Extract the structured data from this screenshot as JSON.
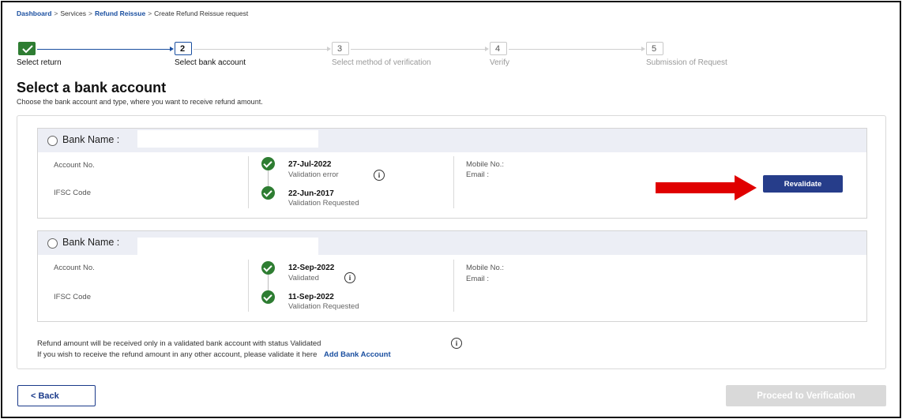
{
  "breadcrumb": {
    "items": [
      "Dashboard",
      "Services",
      "Refund Reissue",
      "Create Refund Reissue request"
    ],
    "separator": ">"
  },
  "stepper": {
    "steps": [
      {
        "number": "",
        "label": "Select return",
        "state": "completed"
      },
      {
        "number": "2",
        "label": "Select bank account",
        "state": "active"
      },
      {
        "number": "3",
        "label": "Select method of verification",
        "state": "pending"
      },
      {
        "number": "4",
        "label": "Verify",
        "state": "pending"
      },
      {
        "number": "5",
        "label": "Submission of Request",
        "state": "pending"
      }
    ]
  },
  "page": {
    "title": "Select a bank account",
    "subtitle": "Choose the bank account and type, where you want to receive refund amount."
  },
  "accounts": [
    {
      "bank_name_label": "Bank Name :",
      "account_no_label": "Account No.",
      "ifsc_label": "IFSC Code",
      "event1_date": "27-Jul-2022",
      "event1_status": "Validation error",
      "event2_date": "22-Jun-2017",
      "event2_status": "Validation Requested",
      "mobile_label": "Mobile No.:",
      "email_label": "Email :",
      "action_label": "Revalidate"
    },
    {
      "bank_name_label": "Bank Name :",
      "account_no_label": "Account No.",
      "ifsc_label": "IFSC Code",
      "event1_date": "12-Sep-2022",
      "event1_status": "Validated",
      "event2_date": "11-Sep-2022",
      "event2_status": "Validation Requested",
      "mobile_label": "Mobile No.:",
      "email_label": "Email :"
    }
  ],
  "notes": {
    "line1": "Refund amount will be received only in a validated bank account with status Validated",
    "line2": "If you wish to receive the refund amount in any other account, please validate it here",
    "add_link": "Add Bank Account"
  },
  "footer": {
    "back_label": "< Back",
    "proceed_label": "Proceed to Verification"
  },
  "icons": {
    "info": "i"
  },
  "colors": {
    "accent": "#1a4fa0",
    "success": "#2e7d32",
    "button_primary": "#263d8a",
    "button_disabled": "#d9d9d9",
    "annotation_arrow": "#e00000"
  }
}
